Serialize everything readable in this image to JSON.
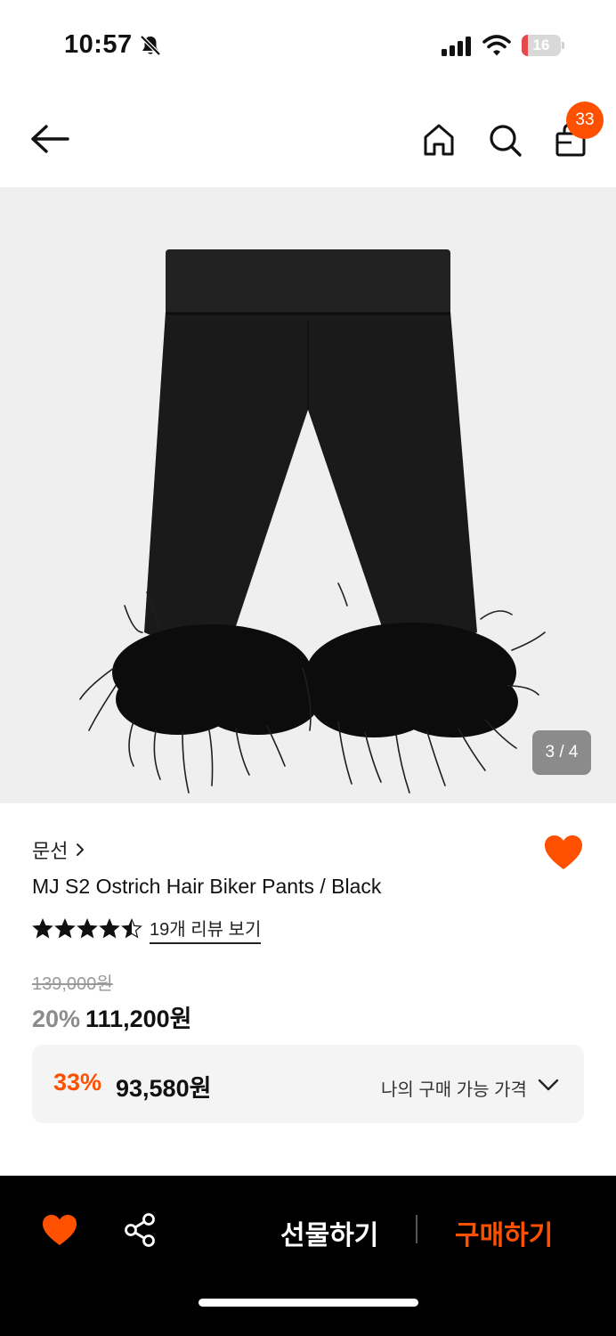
{
  "status_bar": {
    "time": "10:57",
    "battery_level": "16",
    "battery_fraction": 0.16,
    "icons": [
      "bell-slash-icon",
      "signal-icon",
      "wifi-icon",
      "battery-icon"
    ]
  },
  "header": {
    "icons": [
      "back-arrow-icon",
      "home-icon",
      "search-icon",
      "shopping-bag-icon"
    ],
    "cart_count": "33"
  },
  "gallery": {
    "counter": "3 / 4",
    "image_subject": "black biker pants with ostrich feather hem"
  },
  "product": {
    "brand": "문선",
    "name": "MJ S2 Ostrich Hair Biker Pants / Black",
    "rating_stars": 4.5,
    "review_link": "19개 리뷰 보기",
    "original_price": "139,000원",
    "discount_percent": "20%",
    "sale_price": "111,200원"
  },
  "my_price": {
    "percent": "33%",
    "price": "93,580원",
    "label": "나의 구매 가능 가격"
  },
  "bottom_bar": {
    "gift_label": "선물하기",
    "buy_label": "구매하기"
  },
  "colors": {
    "accent": "#ff5000",
    "gallery_bg": "#efefef",
    "price_box_bg": "#f4f4f4",
    "bottom_bar_bg": "#000000"
  }
}
